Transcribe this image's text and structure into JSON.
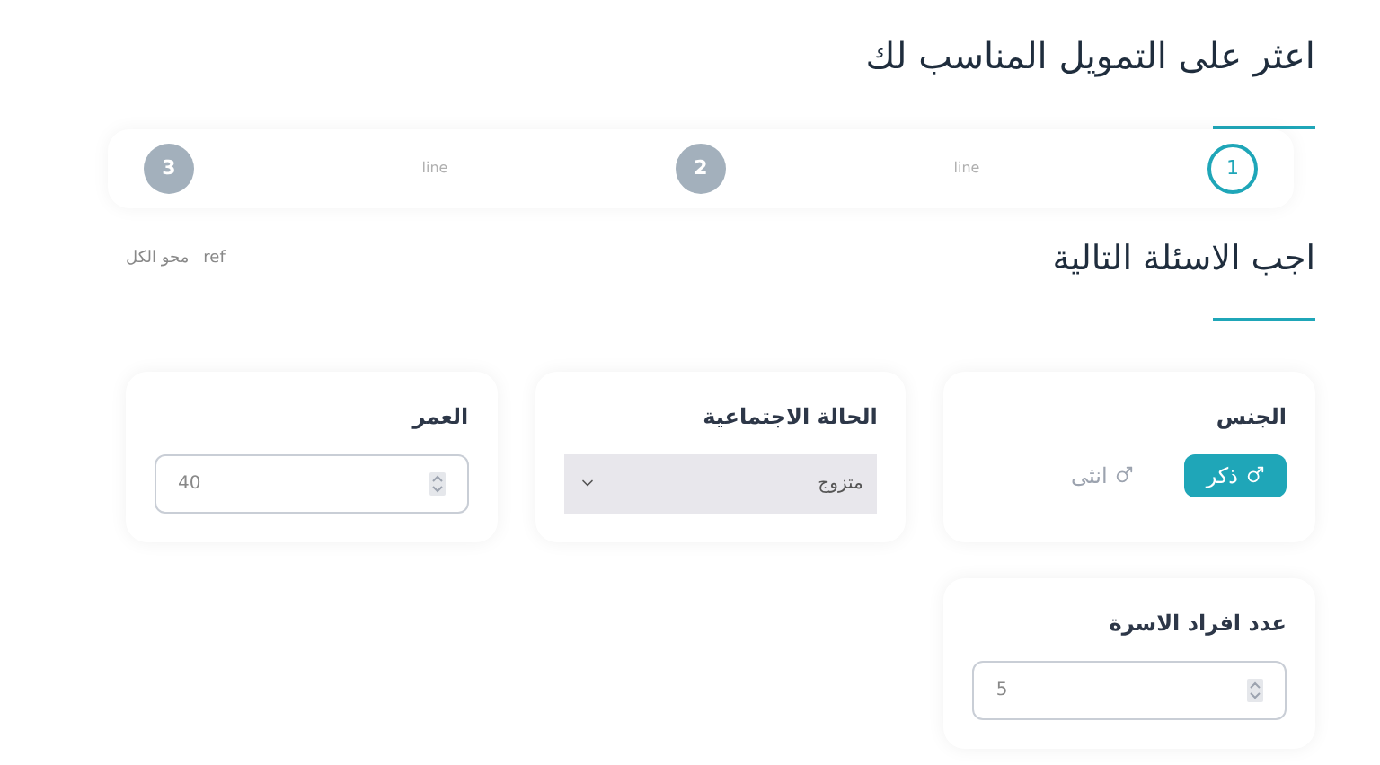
{
  "title": "اعثر على التمويل المناسب لك",
  "steps": [
    {
      "label": "1",
      "selected": true
    },
    {
      "label": "2",
      "selected": false
    },
    {
      "label": "3",
      "selected": false
    }
  ],
  "step_connectors": [
    "line",
    "line"
  ],
  "section": {
    "title": "اجب الاسئلة التالية",
    "links": [
      "ref",
      "محو الكل"
    ]
  },
  "fields": [
    {
      "kind": "choice",
      "label": "الجنس",
      "options": [
        {
          "label": "ذكر",
          "selected": true
        },
        {
          "label": "انثى",
          "selected": false
        }
      ]
    },
    {
      "kind": "select",
      "label": "الحالة الاجتماعية",
      "value": "متزوج"
    },
    {
      "kind": "number",
      "label": "العمر",
      "value": "40"
    },
    {
      "kind": "number",
      "label": "عدد افراد الاسرة",
      "value": "5"
    }
  ]
}
